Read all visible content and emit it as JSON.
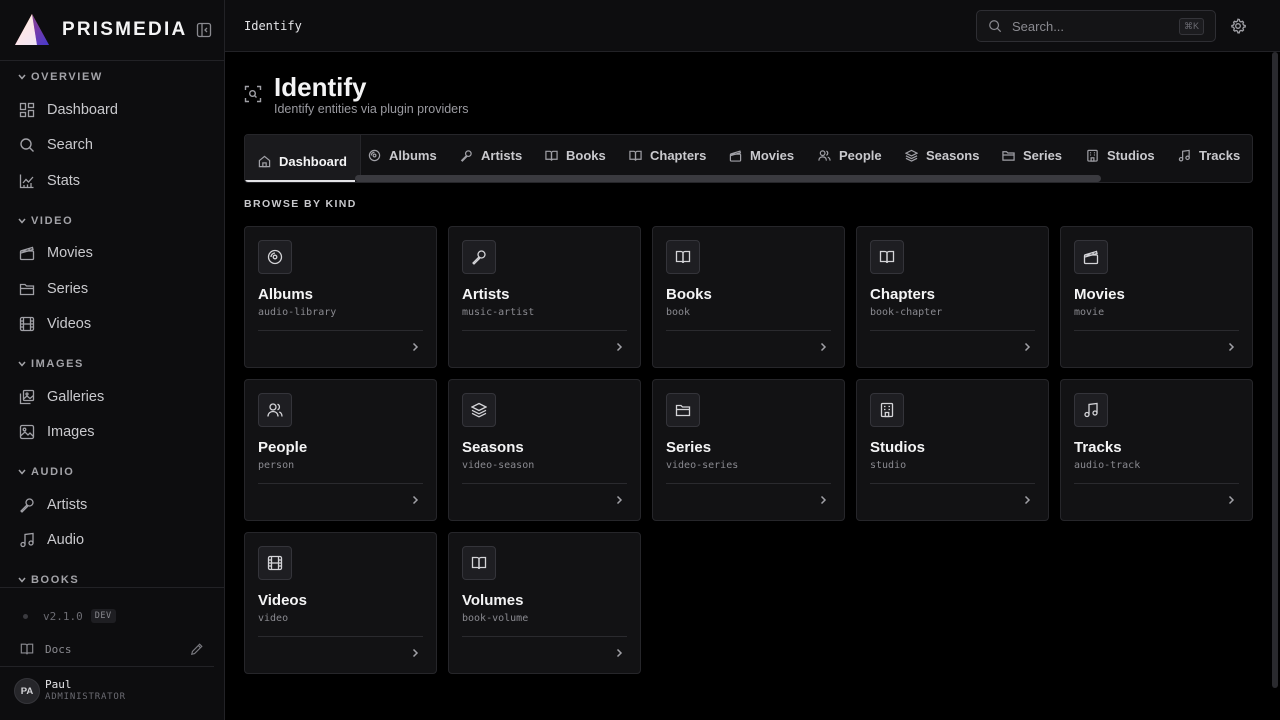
{
  "brand": {
    "name": "PRISMEDIA"
  },
  "sidebar": {
    "sections": [
      {
        "label": "OVERVIEW",
        "items": [
          {
            "label": "Dashboard",
            "icon": "dashboard-icon"
          },
          {
            "label": "Search",
            "icon": "search-icon"
          },
          {
            "label": "Stats",
            "icon": "chart-icon"
          }
        ]
      },
      {
        "label": "VIDEO",
        "items": [
          {
            "label": "Movies",
            "icon": "clapperboard-icon"
          },
          {
            "label": "Series",
            "icon": "folder-icon"
          },
          {
            "label": "Videos",
            "icon": "film-icon"
          }
        ]
      },
      {
        "label": "IMAGES",
        "items": [
          {
            "label": "Galleries",
            "icon": "gallery-icon"
          },
          {
            "label": "Images",
            "icon": "image-icon"
          }
        ]
      },
      {
        "label": "AUDIO",
        "items": [
          {
            "label": "Artists",
            "icon": "microphone-icon"
          },
          {
            "label": "Audio",
            "icon": "music-icon"
          }
        ]
      },
      {
        "label": "BOOKS",
        "items": []
      }
    ],
    "footer": {
      "version": "v2.1.0",
      "badge": "DEV",
      "docs": "Docs"
    },
    "user": {
      "initials": "PA",
      "name": "Paul",
      "role": "ADMINISTRATOR"
    }
  },
  "topbar": {
    "breadcrumb": "Identify",
    "search_placeholder": "Search...",
    "shortcut": "⌘K"
  },
  "page": {
    "title": "Identify",
    "subtitle": "Identify entities via plugin providers"
  },
  "tabs": [
    {
      "label": "Dashboard",
      "icon": "home-icon",
      "active": true
    },
    {
      "label": "Albums",
      "icon": "disc-icon"
    },
    {
      "label": "Artists",
      "icon": "microphone-icon"
    },
    {
      "label": "Books",
      "icon": "book-icon"
    },
    {
      "label": "Chapters",
      "icon": "book-icon"
    },
    {
      "label": "Movies",
      "icon": "clapperboard-icon"
    },
    {
      "label": "People",
      "icon": "users-icon"
    },
    {
      "label": "Seasons",
      "icon": "layers-icon"
    },
    {
      "label": "Series",
      "icon": "folder-icon"
    },
    {
      "label": "Studios",
      "icon": "building-icon"
    },
    {
      "label": "Tracks",
      "icon": "music-icon"
    }
  ],
  "browse": {
    "label": "BROWSE BY KIND",
    "cards": [
      {
        "title": "Albums",
        "kind": "audio-library",
        "icon": "disc-icon"
      },
      {
        "title": "Artists",
        "kind": "music-artist",
        "icon": "microphone-icon"
      },
      {
        "title": "Books",
        "kind": "book",
        "icon": "book-icon"
      },
      {
        "title": "Chapters",
        "kind": "book-chapter",
        "icon": "book-icon"
      },
      {
        "title": "Movies",
        "kind": "movie",
        "icon": "clapperboard-icon"
      },
      {
        "title": "People",
        "kind": "person",
        "icon": "users-icon"
      },
      {
        "title": "Seasons",
        "kind": "video-season",
        "icon": "layers-icon"
      },
      {
        "title": "Series",
        "kind": "video-series",
        "icon": "folder-icon"
      },
      {
        "title": "Studios",
        "kind": "studio",
        "icon": "building-icon"
      },
      {
        "title": "Tracks",
        "kind": "audio-track",
        "icon": "music-icon"
      },
      {
        "title": "Videos",
        "kind": "video",
        "icon": "film-icon"
      },
      {
        "title": "Volumes",
        "kind": "book-volume",
        "icon": "book-icon"
      }
    ]
  }
}
